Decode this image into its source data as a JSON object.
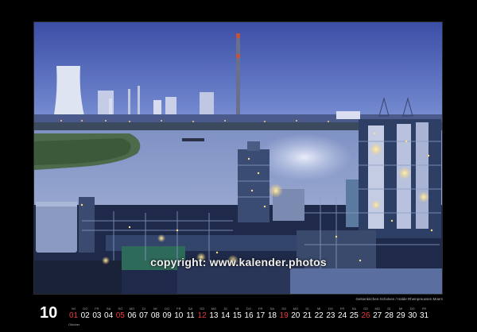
{
  "calendar": {
    "month_number": "10",
    "month_name": "Oktober",
    "weekday_labels": [
      "MI",
      "DO",
      "FR",
      "SA",
      "SO",
      "MO",
      "DI",
      "MI",
      "DO",
      "FR",
      "SA",
      "SO",
      "MO",
      "DI",
      "MI",
      "DO",
      "FR",
      "SA",
      "SO",
      "MO",
      "DI",
      "MI",
      "DO",
      "FR",
      "SA",
      "SO",
      "MO",
      "DI",
      "MI",
      "DO",
      "FR"
    ],
    "days": [
      "01",
      "02",
      "03",
      "04",
      "05",
      "06",
      "07",
      "08",
      "09",
      "10",
      "11",
      "12",
      "13",
      "14",
      "15",
      "16",
      "17",
      "18",
      "19",
      "20",
      "21",
      "22",
      "23",
      "24",
      "25",
      "26",
      "27",
      "28",
      "29",
      "30",
      "31"
    ],
    "highlight_days": [
      "01",
      "05",
      "12",
      "19",
      "26"
    ],
    "highlight_color": "#e43b3b"
  },
  "photo": {
    "caption": "Gelsenkirchen-Scholven / Halde Rheinpreussen Moers",
    "watermark": "copyright: www.kalender.photos"
  },
  "colors": {
    "background": "#000000",
    "sky": "#4a5fb0",
    "river": "#8a9cc8",
    "plant_lights": "#ffd27a"
  }
}
